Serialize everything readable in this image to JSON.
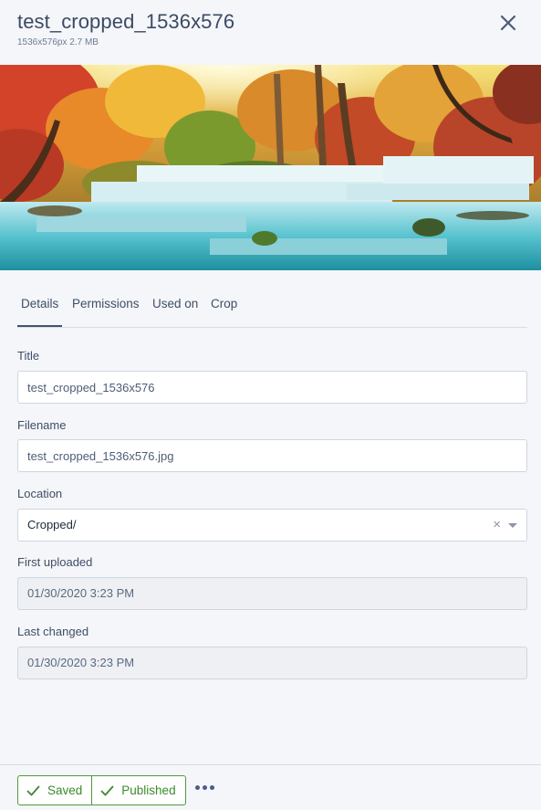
{
  "header": {
    "title": "test_cropped_1536x576",
    "meta": "1536x576px 2.7 MB",
    "close_icon": "close-icon"
  },
  "preview": {
    "image": "waterfall-landscape-image"
  },
  "tabs": [
    {
      "label": "Details",
      "active": true
    },
    {
      "label": "Permissions",
      "active": false
    },
    {
      "label": "Used on",
      "active": false
    },
    {
      "label": "Crop",
      "active": false
    }
  ],
  "form": {
    "title": {
      "label": "Title",
      "value": "test_cropped_1536x576"
    },
    "filename": {
      "label": "Filename",
      "value": "test_cropped_1536x576.jpg"
    },
    "location": {
      "label": "Location",
      "value": "Cropped/",
      "clear": "×"
    },
    "first_uploaded": {
      "label": "First uploaded",
      "value": "01/30/2020 3:23 PM"
    },
    "last_changed": {
      "label": "Last changed",
      "value": "01/30/2020 3:23 PM"
    }
  },
  "footer": {
    "saved_label": "Saved",
    "published_label": "Published",
    "check_icon": "check-icon",
    "more_icon": "more-dots-icon"
  },
  "colors": {
    "background": "#f4f6f9",
    "text": "#43536d",
    "success": "#3b8a2c",
    "more_dots": "#4a5a8c"
  }
}
